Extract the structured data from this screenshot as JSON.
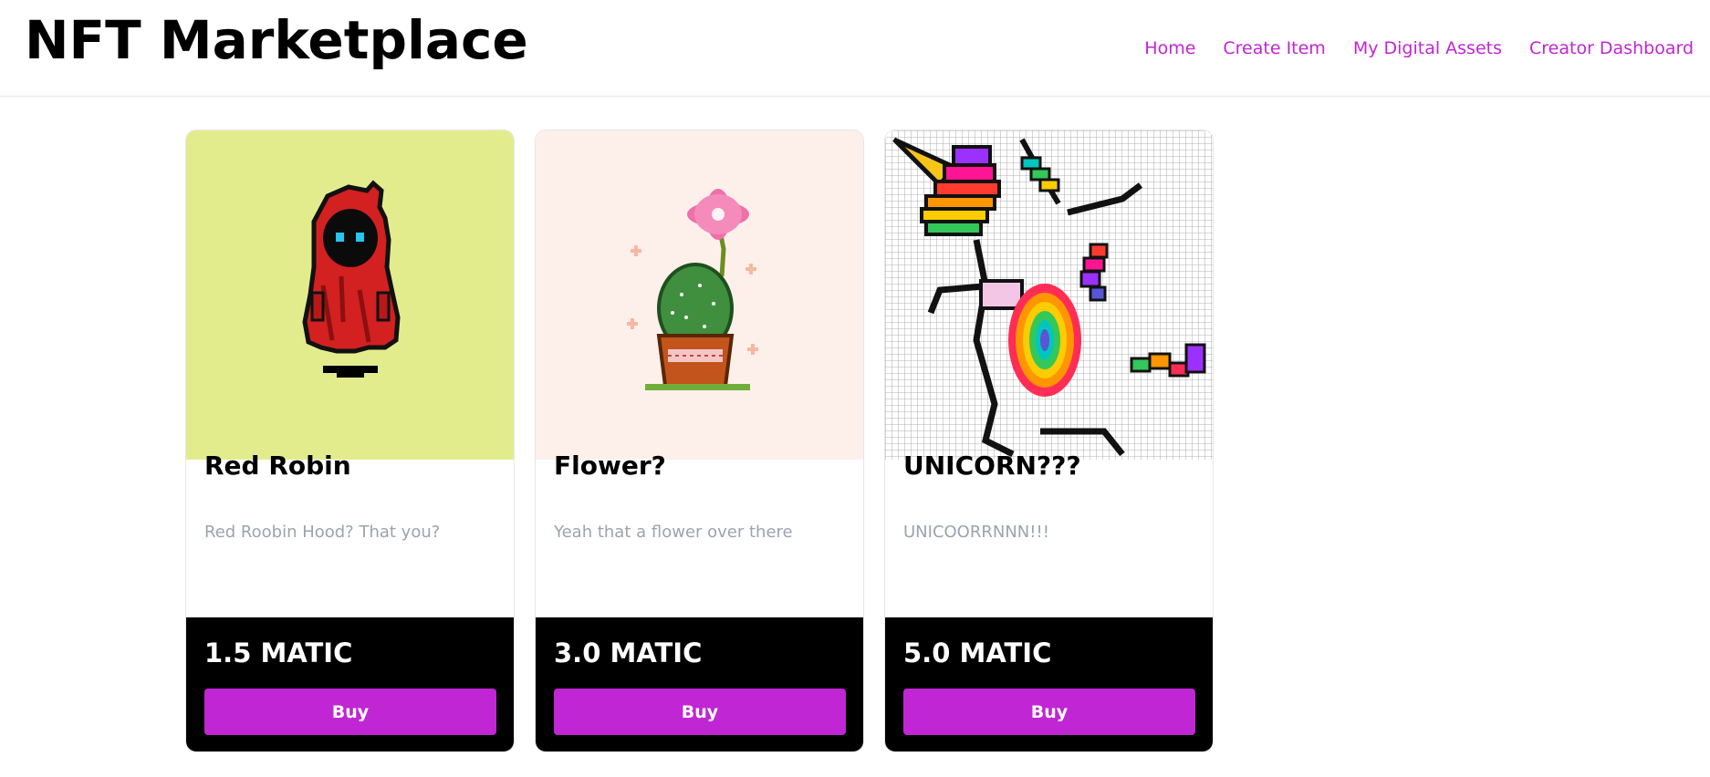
{
  "header": {
    "title": "NFT Marketplace",
    "nav": [
      {
        "label": "Home"
      },
      {
        "label": "Create Item"
      },
      {
        "label": "My Digital Assets"
      },
      {
        "label": "Creator Dashboard"
      }
    ]
  },
  "colors": {
    "accent": "#c026d3",
    "nav_link": "#c026d3",
    "price_bar": "#000000"
  },
  "items": [
    {
      "name": "Red Robin",
      "description": "Red Roobin Hood? That you?",
      "price": "1.5 MATIC",
      "buy_label": "Buy",
      "image": "red-hooded-figure-pixel-art",
      "bg": "#e3ec8d"
    },
    {
      "name": "Flower?",
      "description": "Yeah that a flower over there",
      "price": "3.0 MATIC",
      "buy_label": "Buy",
      "image": "potted-cactus-flower-pixel-art",
      "bg": "#fdf0ea"
    },
    {
      "name": "UNICORN???",
      "description": "UNICOORRNNN!!!",
      "price": "5.0 MATIC",
      "buy_label": "Buy",
      "image": "rainbow-unicorn-pixel-art",
      "bg": "#ffffff"
    }
  ]
}
